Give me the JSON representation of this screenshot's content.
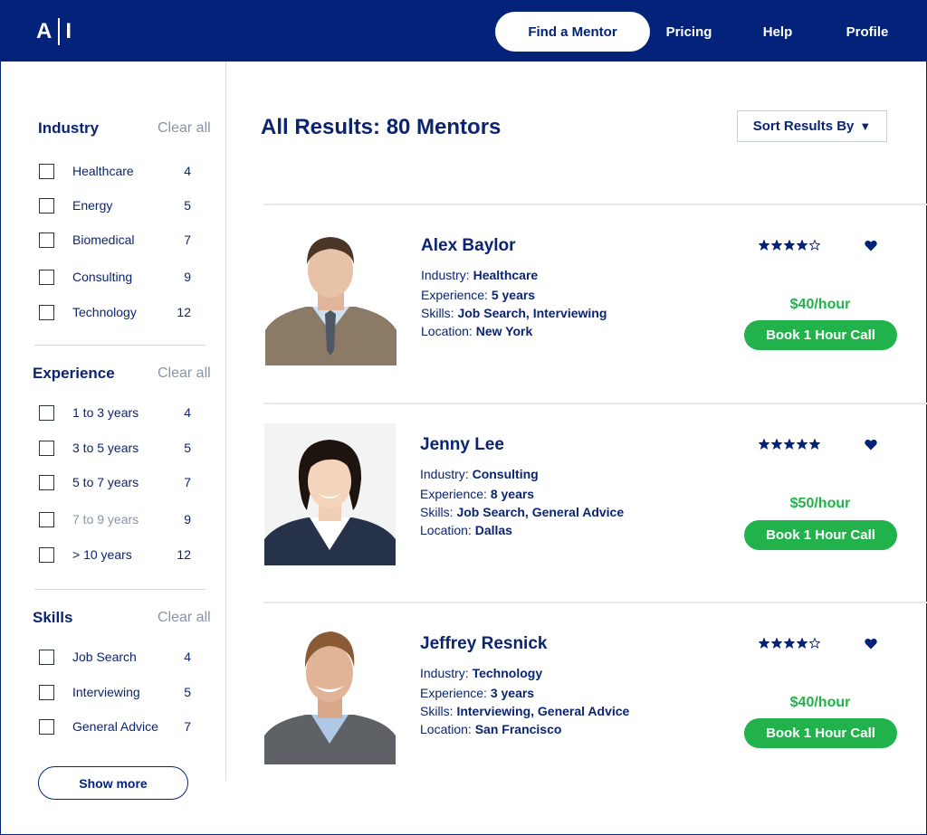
{
  "header": {
    "logo_left": "A",
    "logo_right": "I",
    "nav": [
      {
        "label": "Find a Mentor",
        "active": true
      },
      {
        "label": "Pricing",
        "active": false
      },
      {
        "label": "Help",
        "active": false
      },
      {
        "label": "Profile",
        "active": false
      }
    ]
  },
  "sidebar": {
    "clear_all_label": "Clear all",
    "show_more_label": "Show more",
    "industry": {
      "title": "Industry",
      "items": [
        {
          "label": "Healthcare",
          "count": "4"
        },
        {
          "label": "Energy",
          "count": "5"
        },
        {
          "label": "Biomedical",
          "count": "7"
        },
        {
          "label": "Consulting",
          "count": "9"
        },
        {
          "label": "Technology",
          "count": "12"
        }
      ]
    },
    "experience": {
      "title": "Experience",
      "items": [
        {
          "label": "1 to 3 years",
          "count": "4"
        },
        {
          "label": "3 to 5 years",
          "count": "5"
        },
        {
          "label": "5 to 7 years",
          "count": "7"
        },
        {
          "label": "7 to 9 years",
          "count": "9"
        },
        {
          "label": "> 10 years",
          "count": "12"
        }
      ]
    },
    "skills": {
      "title": "Skills",
      "items": [
        {
          "label": "Job Search",
          "count": "4"
        },
        {
          "label": "Interviewing",
          "count": "5"
        },
        {
          "label": "General Advice",
          "count": "7"
        }
      ]
    }
  },
  "main": {
    "results_title": "All Results: 80 Mentors",
    "sort_label": "Sort Results By",
    "sort_caret": "▼",
    "labels": {
      "industry": "Industry: ",
      "experience": "Experience: ",
      "skills": "Skills: ",
      "location": "Location: "
    },
    "mentors": [
      {
        "name": "Alex Baylor",
        "industry": "Healthcare",
        "experience": "5 years",
        "skills": "Job Search, Interviewing",
        "location": "New York",
        "rating": 4,
        "price": "$40/hour",
        "book_label": "Book 1 Hour Call"
      },
      {
        "name": "Jenny Lee",
        "industry": "Consulting",
        "experience": "8 years",
        "skills": "Job Search, General Advice",
        "location": "Dallas",
        "rating": 5,
        "price": "$50/hour",
        "book_label": "Book 1 Hour Call"
      },
      {
        "name": "Jeffrey Resnick",
        "industry": "Technology",
        "experience": "3 years",
        "skills": "Interviewing, General Advice",
        "location": "San Francisco",
        "rating": 4,
        "price": "$40/hour",
        "book_label": "Book 1 Hour Call"
      }
    ]
  },
  "colors": {
    "navy": "#03237b",
    "text": "#0b2470",
    "green": "#22b24c",
    "muted": "#8a93aa"
  }
}
